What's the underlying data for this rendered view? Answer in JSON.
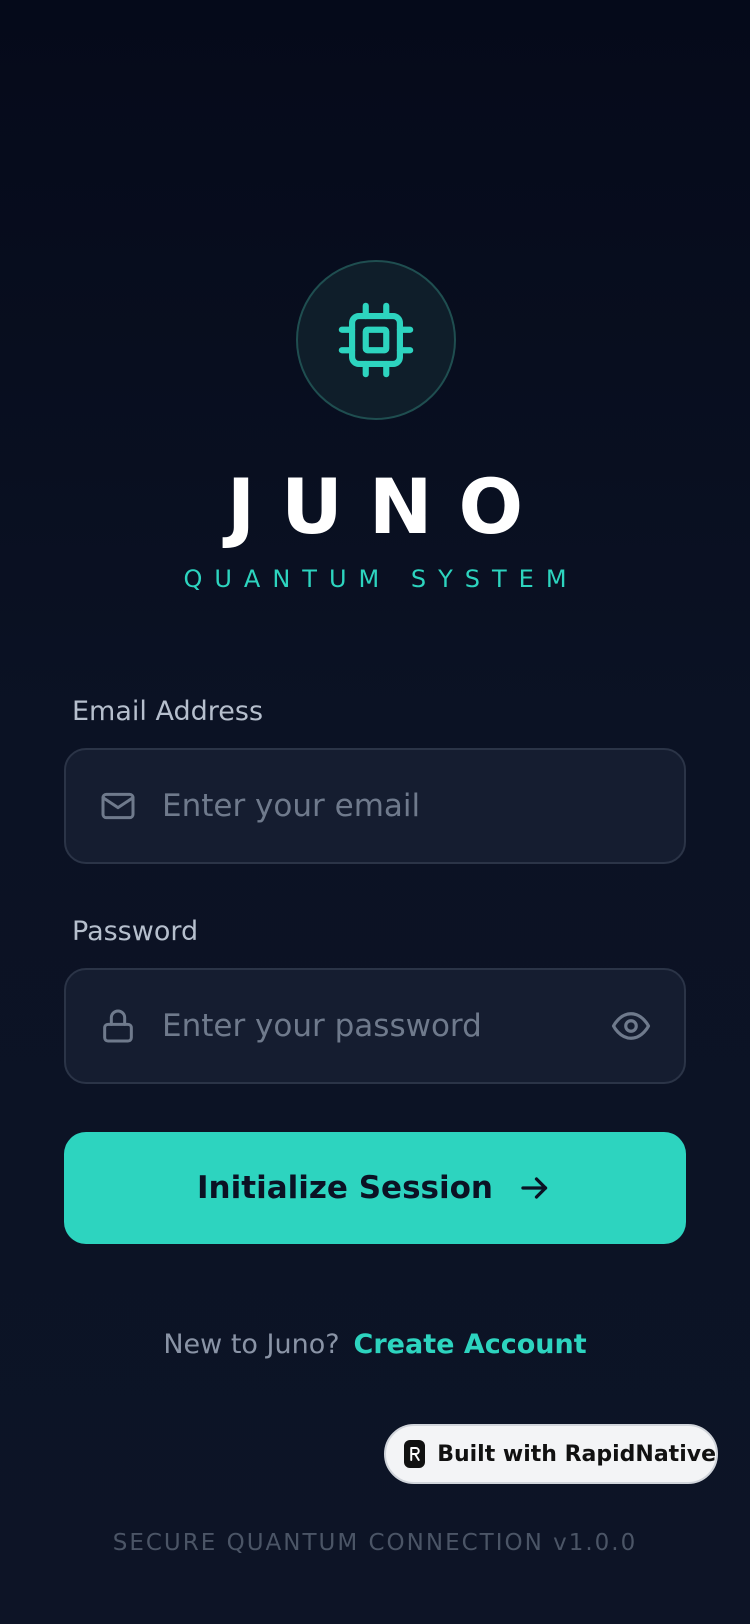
{
  "brand": {
    "title": "JUNO",
    "subtitle": "QUANTUM SYSTEM",
    "logo_icon": "cpu-chip-icon"
  },
  "form": {
    "email": {
      "label": "Email Address",
      "placeholder": "Enter your email",
      "value": "",
      "icon": "mail-icon"
    },
    "password": {
      "label": "Password",
      "placeholder": "Enter your password",
      "value": "",
      "icon": "lock-icon",
      "toggle_icon": "eye-icon"
    },
    "submit_label": "Initialize Session",
    "submit_icon": "arrow-right-icon"
  },
  "signup": {
    "prompt": "New to Juno?",
    "link_label": "Create Account"
  },
  "badge": {
    "label": "Built with RapidNative"
  },
  "footer": {
    "version_text": "SECURE QUANTUM CONNECTION v1.0.0"
  },
  "colors": {
    "accent": "#2dd4bf",
    "background": "#0b1224",
    "field_background": "#151d30",
    "field_border": "#2b3447",
    "label": "#b6bfcd",
    "placeholder": "#6f7a8c"
  }
}
